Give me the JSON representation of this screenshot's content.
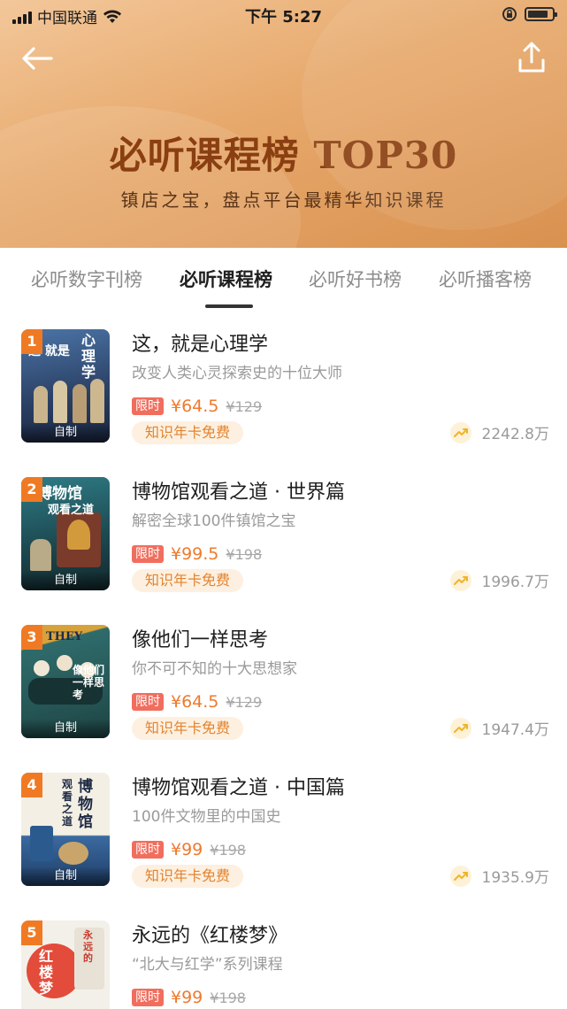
{
  "status_bar": {
    "carrier": "中国联通",
    "time": "下午 5:27"
  },
  "header": {
    "title": "必听课程榜 TOP30",
    "subtitle": "镇店之宝，盘点平台最精华知识课程",
    "back_icon": "arrow-left-icon",
    "share_icon": "share-upload-icon"
  },
  "tabs": [
    {
      "label": "必听数字刊榜",
      "active": false
    },
    {
      "label": "必听课程榜",
      "active": true
    },
    {
      "label": "必听好书榜",
      "active": false
    },
    {
      "label": "必听播客榜",
      "active": false
    }
  ],
  "courses": [
    {
      "rank": "1",
      "title": "这，就是心理学",
      "subtitle": "改变人类心灵探索史的十位大师",
      "limit_label": "限时",
      "price": "¥64.5",
      "original_price": "¥129",
      "free_label": "知识年卡免费",
      "plays": "2242.8万",
      "cover_tag": "自制",
      "cover_text_a": "这 就是",
      "cover_text_b": "心理学",
      "cover_colors": [
        "#3e5f8f",
        "#1f2f4f"
      ]
    },
    {
      "rank": "2",
      "title": "博物馆观看之道 · 世界篇",
      "subtitle": "解密全球100件镇馆之宝",
      "limit_label": "限时",
      "price": "¥99.5",
      "original_price": "¥198",
      "free_label": "知识年卡免费",
      "plays": "1996.7万",
      "cover_tag": "自制",
      "cover_text_a": "博物馆",
      "cover_text_b": "观看之道",
      "cover_colors": [
        "#2a6f78",
        "#17363d"
      ]
    },
    {
      "rank": "3",
      "title": "像他们一样思考",
      "subtitle": "你不可不知的十大思想家",
      "limit_label": "限时",
      "price": "¥64.5",
      "original_price": "¥129",
      "free_label": "知识年卡免费",
      "plays": "1947.4万",
      "cover_tag": "自制",
      "cover_text_a": "THEY",
      "cover_text_b": "像他们一样思考",
      "cover_colors": [
        "#2f6a6a",
        "#1a3838"
      ]
    },
    {
      "rank": "4",
      "title": "博物馆观看之道 · 中国篇",
      "subtitle": "100件文物里的中国史",
      "limit_label": "限时",
      "price": "¥99",
      "original_price": "¥198",
      "free_label": "知识年卡免费",
      "plays": "1935.9万",
      "cover_tag": "自制",
      "cover_text_a": "观看之道",
      "cover_text_b": "博物馆",
      "cover_colors": [
        "#f1ede2",
        "#3b6aa0"
      ]
    },
    {
      "rank": "5",
      "title": "永远的《红楼梦》",
      "subtitle": "“北大与红学”系列课程",
      "limit_label": "限时",
      "price": "¥99",
      "original_price": "¥198",
      "free_label": "",
      "plays": "",
      "cover_tag": "",
      "cover_text_a": "永远的",
      "cover_text_b": "红楼梦",
      "cover_colors": [
        "#f3f0ea",
        "#e34b3a"
      ]
    }
  ],
  "icons": {
    "trend": "trend-up-icon",
    "wifi": "wifi-icon",
    "battery": "battery-icon",
    "signal": "signal-icon",
    "orientation_lock": "orientation-lock-icon"
  },
  "colors": {
    "accent": "#ee7a2e",
    "limit_badge": "#f16e5e",
    "header_gradient": [
      "#f3c79a",
      "#d9914f"
    ],
    "hero_title": "#8a3f12"
  }
}
